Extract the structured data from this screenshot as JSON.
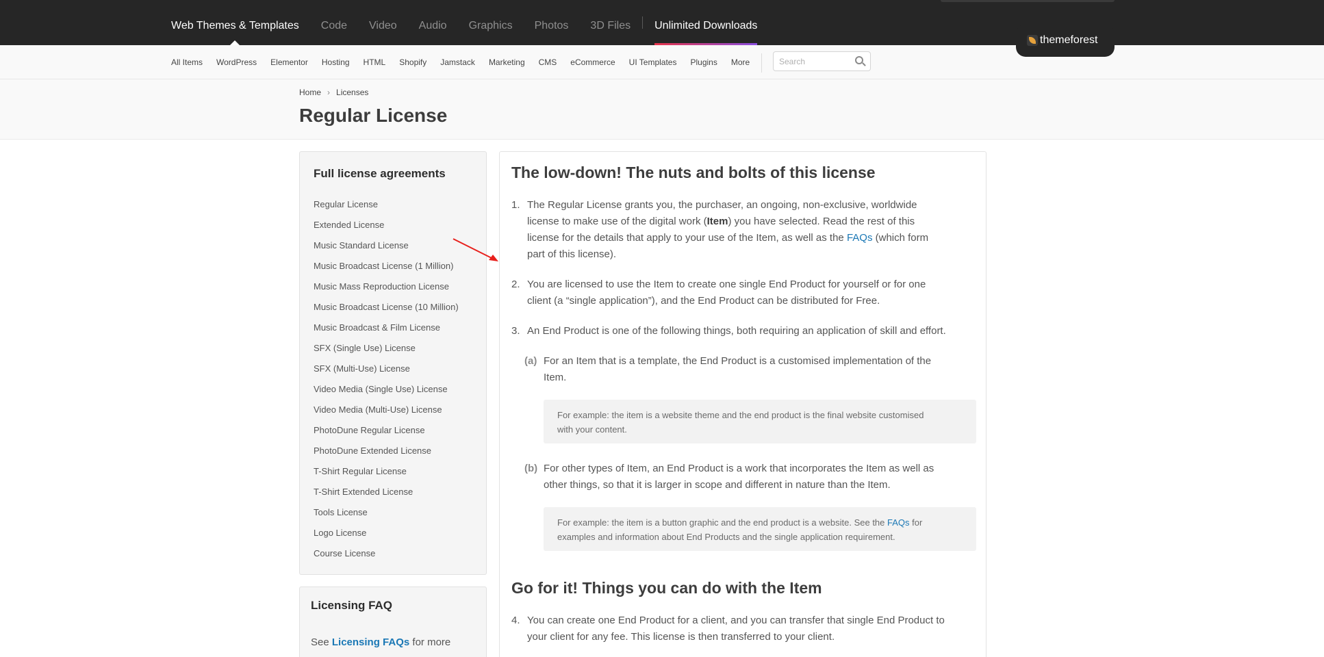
{
  "topnav": {
    "items": [
      "Web Themes & Templates",
      "Code",
      "Video",
      "Audio",
      "Graphics",
      "Photos",
      "3D Files"
    ],
    "unlimited": "Unlimited Downloads",
    "logo_text": "themeforest"
  },
  "subnav": {
    "items": [
      "All Items",
      "WordPress",
      "Elementor",
      "Hosting",
      "HTML",
      "Shopify",
      "Jamstack",
      "Marketing",
      "CMS",
      "eCommerce",
      "UI Templates",
      "Plugins",
      "More"
    ],
    "search_placeholder": "Search"
  },
  "breadcrumb": {
    "home": "Home",
    "current": "Licenses"
  },
  "page_title": "Regular License",
  "sidebar": {
    "title": "Full license agreements",
    "items": [
      "Regular License",
      "Extended License",
      "Music Standard License",
      "Music Broadcast License (1 Million)",
      "Music Mass Reproduction License",
      "Music Broadcast License (10 Million)",
      "Music Broadcast & Film License",
      "SFX (Single Use) License",
      "SFX (Multi-Use) License",
      "Video Media (Single Use) License",
      "Video Media (Multi-Use) License",
      "PhotoDune Regular License",
      "PhotoDune Extended License",
      "T-Shirt Regular License",
      "T-Shirt Extended License",
      "Tools License",
      "Logo License",
      "Course License"
    ]
  },
  "faq": {
    "title": "Licensing FAQ",
    "prefix": "See",
    "link": "Licensing FAQs",
    "suffix": "for more"
  },
  "main": {
    "heading1": "The low-down! The nuts and bolts of this license",
    "item1": {
      "num": "1.",
      "line1": "The Regular License grants you, the purchaser, an ongoing, non-exclusive, worldwide",
      "line2a": "license to make use of the digital work (",
      "bold": "Item",
      "line2b": ") you have selected. Read the rest of this",
      "line3": "license for the details that apply to your use of the Item, as well as the",
      "link": "FAQs",
      "line3b": "(which form",
      "line4": "part of this license)."
    },
    "item2": {
      "num": "2.",
      "line1": "You are licensed to use the Item to create one single End Product for yourself or for one",
      "line2": "client (a “single application”), and the End Product can be distributed for Free."
    },
    "item3": {
      "num": "3.",
      "line1": "An End Product is one of the following things, both requiring an application of skill and effort."
    },
    "item3a": {
      "num": "(a)",
      "line1": "For an Item that is a template, the End Product is a customised implementation of the",
      "line2": "Item."
    },
    "example_a": {
      "line1": "For example: the item is a website theme and the end product is the final website customised",
      "line2": "with your content."
    },
    "item3b": {
      "num": "(b)",
      "line1": "For other types of Item, an End Product is a work that incorporates the Item as well as",
      "line2": "other things, so that it is larger in scope and different in nature than the Item."
    },
    "example_b": {
      "line1a": "For example: the item is a button graphic and the end product is a website. See the",
      "link": "FAQs",
      "line1b": "for",
      "line2": "examples and information about End Products and the single application requirement."
    },
    "heading2": "Go for it! Things you can do with the Item",
    "item4": {
      "num": "4.",
      "line1": "You can create one End Product for a client, and you can transfer that single End Product to",
      "line2": "your client for any fee. This license is then transferred to your client."
    }
  },
  "colors": {
    "accent_link": "#1b78b5",
    "topbar_bg": "#262626",
    "annotation_arrow": "#e8201c"
  }
}
